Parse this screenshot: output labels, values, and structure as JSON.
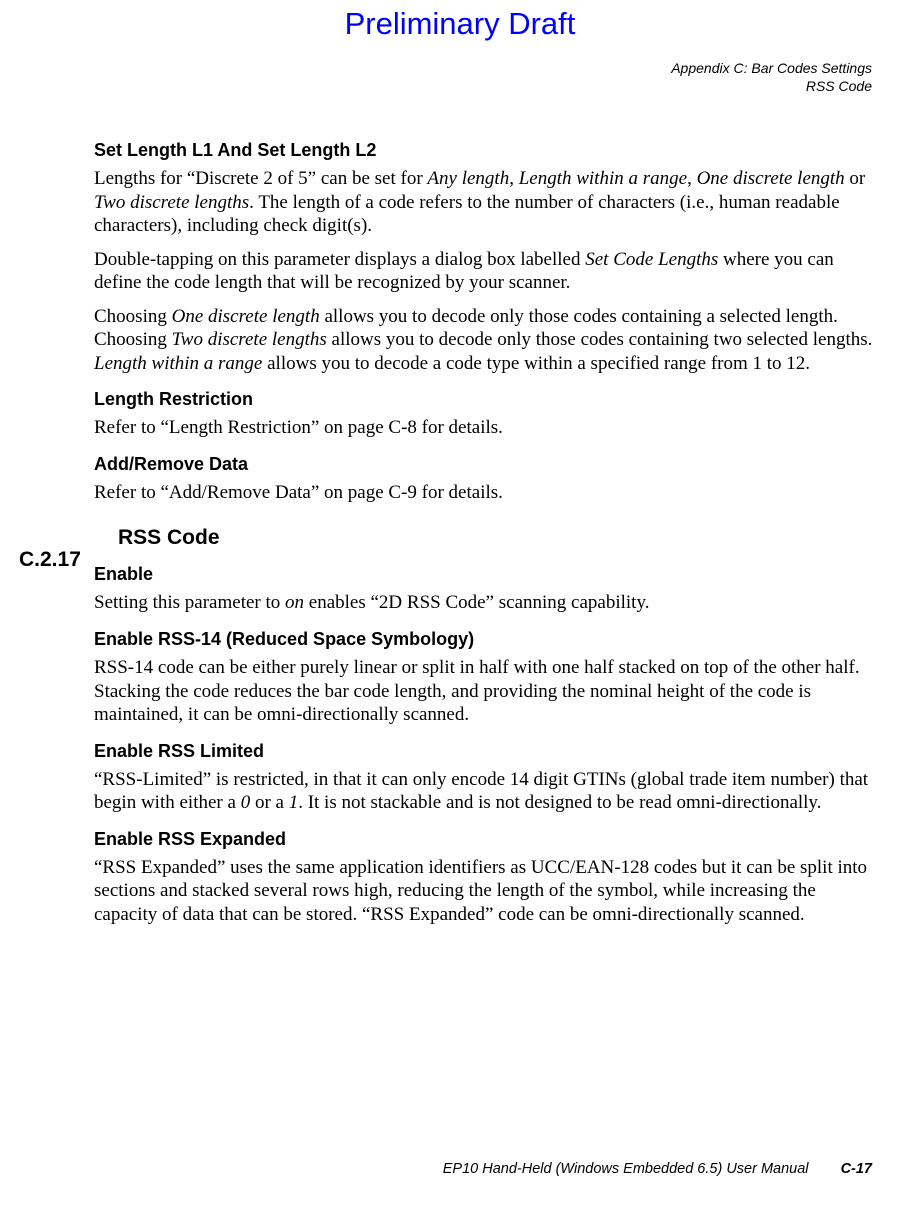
{
  "draft": "Preliminary Draft",
  "header": {
    "line1": "Appendix C: Bar Codes Settings",
    "line2": "RSS Code"
  },
  "s1": {
    "h": "Set Length L1 And Set Length L2",
    "p1a": "Lengths for “Discrete 2 of 5” can be set for ",
    "p1b": "Any length",
    "p1c": ", ",
    "p1d": "Length within a range",
    "p1e": ", ",
    "p1f": "One discrete length",
    "p1g": " or ",
    "p1h": "Two discrete lengths",
    "p1i": ". The length of a code refers to the number of characters (i.e., human readable characters), including check digit(s).",
    "p2a": "Double-tapping on this parameter displays a dialog box labelled ",
    "p2b": "Set Code Lengths",
    "p2c": " where you can define the code length that will be recognized by your scanner.",
    "p3a": "Choosing ",
    "p3b": "One discrete length",
    "p3c": " allows you to decode only those codes containing a selected length. Choosing ",
    "p3d": "Two discrete lengths",
    "p3e": " allows you to decode only those codes containing two selected lengths. ",
    "p3f": "Length within a range",
    "p3g": " allows you to decode a code type within a specified range from 1 to 12."
  },
  "s2": {
    "h": "Length Restriction",
    "p": "Refer to “Length Restriction” on page C-8 for details."
  },
  "s3": {
    "h": "Add/Remove Data",
    "p": "Refer to “Add/Remove Data” on page C-9 for details."
  },
  "sec": {
    "num": "C.2.17",
    "title": "RSS Code"
  },
  "s4": {
    "h": "Enable",
    "pa": "Setting this parameter to ",
    "pb": "on",
    "pc": " enables “2D RSS Code” scanning capability."
  },
  "s5": {
    "h": "Enable RSS-14 (Reduced Space Symbology)",
    "p": "RSS-14 code can be either purely linear or split in half with one half stacked on top of the other half. Stacking the code reduces the bar code length, and providing the nominal height of the code is maintained, it can be omni-directionally scanned."
  },
  "s6": {
    "h": "Enable RSS Limited",
    "pa": "“RSS-Limited” is restricted, in that it can only encode 14 digit GTINs (global trade item number) that begin with either a ",
    "pb": "0",
    "pc": " or a ",
    "pd": "1",
    "pe": ". It is not stackable and is not designed to be read omni-directionally."
  },
  "s7": {
    "h": "Enable RSS Expanded",
    "p": "“RSS Expanded” uses the same application identifiers as UCC/EAN-128 codes but it can be split into sections and stacked several rows high, reducing the length of the symbol, while increasing the capacity of data that can be stored. “RSS Expanded” code can be omni-directionally scanned."
  },
  "footer": {
    "title": "EP10 Hand-Held (Windows Embedded 6.5) User Manual",
    "page": "C-17"
  }
}
